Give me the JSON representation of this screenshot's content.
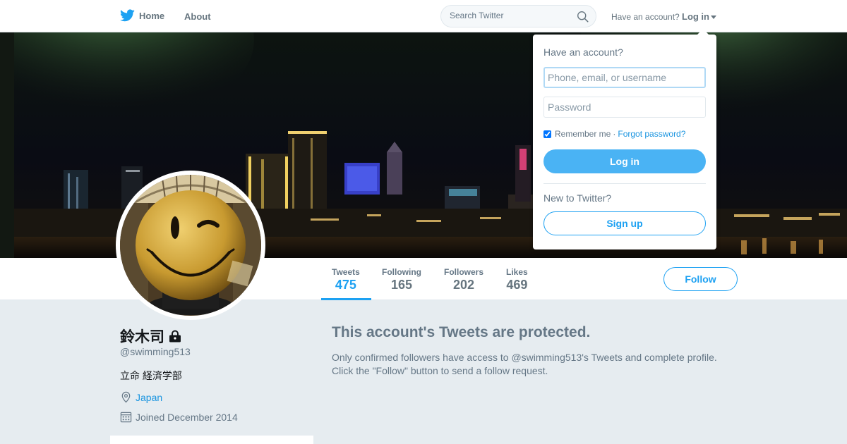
{
  "nav": {
    "home_label": "Home",
    "home_icon": "twitter-bird-icon",
    "about_label": "About",
    "search_placeholder": "Search Twitter",
    "search_icon": "search-icon",
    "have_account_text": "Have an account?",
    "login_label": "Log in"
  },
  "profile": {
    "name": "鈴木司",
    "handle": "@swimming513",
    "bio": "立命 経済学部",
    "location": "Japan",
    "joined": "Joined December 2014",
    "protected_icon": "lock-icon"
  },
  "stats": [
    {
      "label": "Tweets",
      "value": "475",
      "active": true
    },
    {
      "label": "Following",
      "value": "165",
      "active": false
    },
    {
      "label": "Followers",
      "value": "202",
      "active": false
    },
    {
      "label": "Likes",
      "value": "469",
      "active": false
    }
  ],
  "follow_label": "Follow",
  "protected": {
    "title": "This account's Tweets are protected.",
    "line1": "Only confirmed followers have access to @swimming513's Tweets and complete profile.",
    "line2": "Click the \"Follow\" button to send a follow request."
  },
  "login_dropdown": {
    "heading": "Have an account?",
    "username_placeholder": "Phone, email, or username",
    "password_placeholder": "Password",
    "remember_label": "Remember me",
    "remember_checked": true,
    "separator": "·",
    "forgot_label": "Forgot password?",
    "login_button": "Log in",
    "new_text": "New to Twitter?",
    "signup_button": "Sign up"
  },
  "colors": {
    "accent": "#1da1f2",
    "login_button": "#4ab3f4",
    "page_bg": "#e6ecf0",
    "muted_text": "#657786"
  }
}
